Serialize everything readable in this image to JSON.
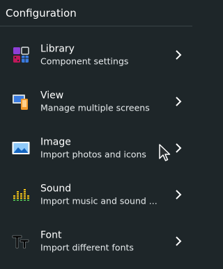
{
  "header": {
    "title": "Configuration"
  },
  "items": [
    {
      "title": "Library",
      "subtitle": "Component settings",
      "icon": "library-icon"
    },
    {
      "title": "View",
      "subtitle": "Manage multiple screens",
      "icon": "devices-icon"
    },
    {
      "title": "Image",
      "subtitle": "Import photos and icons",
      "icon": "image-icon"
    },
    {
      "title": "Sound",
      "subtitle": "Import music and sound ...",
      "icon": "equalizer-icon"
    },
    {
      "title": "Font",
      "subtitle": "Import different fonts",
      "icon": "font-icon"
    }
  ],
  "colors": {
    "background": "#1e2629",
    "divider": "#3a4448",
    "accent_purple": "#8e3fd6",
    "accent_blue": "#3a7be0",
    "accent_orange": "#f39a2b"
  }
}
